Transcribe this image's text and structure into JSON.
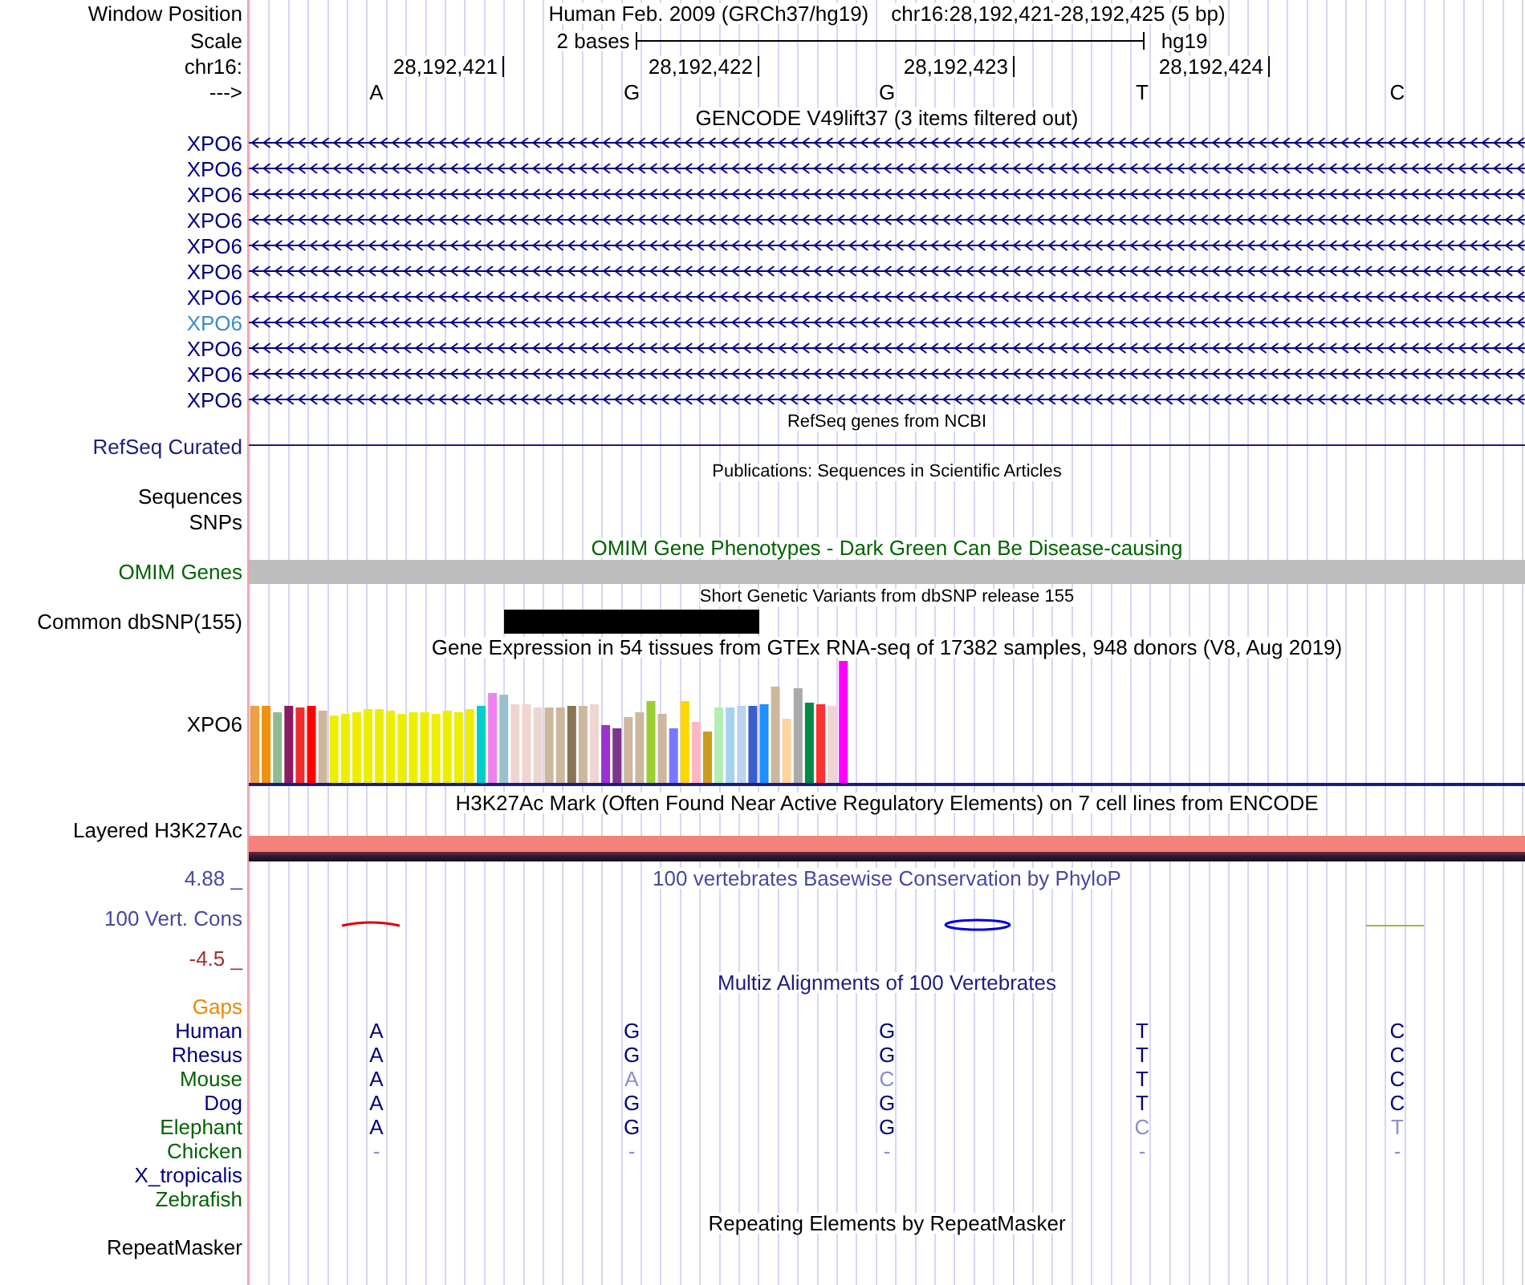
{
  "position": {
    "label": "Window Position",
    "assembly": "Human Feb. 2009 (GRCh37/hg19)",
    "range": "chr16:28,192,421-28,192,425 (5 bp)"
  },
  "scale": {
    "label": "Scale",
    "span": "2 bases",
    "assembly": "hg19"
  },
  "coordinates": {
    "label": "chr16:",
    "ticks": [
      "28,192,421",
      "28,192,422",
      "28,192,423",
      "28,192,424"
    ]
  },
  "strand": {
    "label": "--->",
    "bases": [
      "A",
      "G",
      "G",
      "T",
      "C"
    ]
  },
  "tracks": [
    {
      "kind": "genes",
      "title": "GENCODE V49lift37 (3 items filtered out)",
      "items": [
        {
          "name": "XPO6",
          "color": "#000080"
        },
        {
          "name": "XPO6",
          "color": "#000080"
        },
        {
          "name": "XPO6",
          "color": "#000080"
        },
        {
          "name": "XPO6",
          "color": "#000080"
        },
        {
          "name": "XPO6",
          "color": "#000080"
        },
        {
          "name": "XPO6",
          "color": "#000080"
        },
        {
          "name": "XPO6",
          "color": "#000080"
        },
        {
          "name": "XPO6",
          "color": "#3c8cc8"
        },
        {
          "name": "XPO6",
          "color": "#000080"
        },
        {
          "name": "XPO6",
          "color": "#000080"
        },
        {
          "name": "XPO6",
          "color": "#000080"
        }
      ]
    },
    {
      "kind": "line",
      "title": "RefSeq genes from NCBI",
      "labels": [
        "RefSeq Curated"
      ]
    },
    {
      "kind": "publications",
      "title": "Publications: Sequences in Scientific Articles",
      "labels": [
        "Sequences",
        "SNPs"
      ]
    },
    {
      "kind": "omim",
      "title": "OMIM Gene Phenotypes - Dark Green Can Be Disease-causing",
      "labels": [
        "OMIM Genes"
      ]
    },
    {
      "kind": "variants",
      "title": "Short Genetic Variants from dbSNP release 155",
      "labels": [
        "Common dbSNP(155)"
      ]
    },
    {
      "kind": "expression",
      "title": "Gene Expression in 54 tissues from GTEx RNA-seq of 17382 samples, 948 donors (V8, Aug 2019)",
      "labels": [
        "XPO6"
      ]
    },
    {
      "kind": "layered",
      "title": "H3K27Ac Mark (Often Found Near Active Regulatory Elements) on 7 cell lines from ENCODE",
      "labels": [
        "Layered H3K27Ac"
      ]
    },
    {
      "kind": "wiggle",
      "title": "100 vertebrates Basewise Conservation by PhyloP",
      "labels": [
        "100 Vert. Cons"
      ],
      "max": "4.88 _",
      "min": "-4.5 _"
    },
    {
      "kind": "alignment",
      "title": "Multiz Alignments of 100 Vertebrates",
      "gaps": "Gaps",
      "species": [
        {
          "name": "Human",
          "color": "#000080",
          "bases": [
            {
              "base": "A",
              "dimmed": false
            },
            {
              "base": "G",
              "dimmed": false
            },
            {
              "base": "G",
              "dimmed": false
            },
            {
              "base": "T",
              "dimmed": false
            },
            {
              "base": "C",
              "dimmed": false
            }
          ]
        },
        {
          "name": "Rhesus",
          "color": "#000080",
          "bases": [
            {
              "base": "A",
              "dimmed": false
            },
            {
              "base": "G",
              "dimmed": false
            },
            {
              "base": "G",
              "dimmed": false
            },
            {
              "base": "T",
              "dimmed": false
            },
            {
              "base": "C",
              "dimmed": false
            }
          ]
        },
        {
          "name": "Mouse",
          "color": "#006400",
          "bases": [
            {
              "base": "A",
              "dimmed": false
            },
            {
              "base": "A",
              "dimmed": true
            },
            {
              "base": "C",
              "dimmed": true
            },
            {
              "base": "T",
              "dimmed": false
            },
            {
              "base": "C",
              "dimmed": false
            }
          ]
        },
        {
          "name": "Dog",
          "color": "#000080",
          "bases": [
            {
              "base": "A",
              "dimmed": false
            },
            {
              "base": "G",
              "dimmed": false
            },
            {
              "base": "G",
              "dimmed": false
            },
            {
              "base": "T",
              "dimmed": false
            },
            {
              "base": "C",
              "dimmed": false
            }
          ]
        },
        {
          "name": "Elephant",
          "color": "#006400",
          "bases": [
            {
              "base": "A",
              "dimmed": false
            },
            {
              "base": "G",
              "dimmed": false
            },
            {
              "base": "G",
              "dimmed": false
            },
            {
              "base": "C",
              "dimmed": true
            },
            {
              "base": "T",
              "dimmed": true
            }
          ]
        },
        {
          "name": "Chicken",
          "color": "#006400",
          "bases": [
            {
              "base": "-",
              "dimmed": true
            },
            {
              "base": "-",
              "dimmed": true
            },
            {
              "base": "-",
              "dimmed": true
            },
            {
              "base": "-",
              "dimmed": true
            },
            {
              "base": "-",
              "dimmed": true
            }
          ]
        },
        {
          "name": "X_tropicalis",
          "color": "#000080"
        },
        {
          "name": "Zebrafish",
          "color": "#006400"
        }
      ]
    },
    {
      "kind": "repeats",
      "title": "Repeating Elements by RepeatMasker",
      "labels": [
        "RepeatMasker"
      ]
    }
  ]
}
